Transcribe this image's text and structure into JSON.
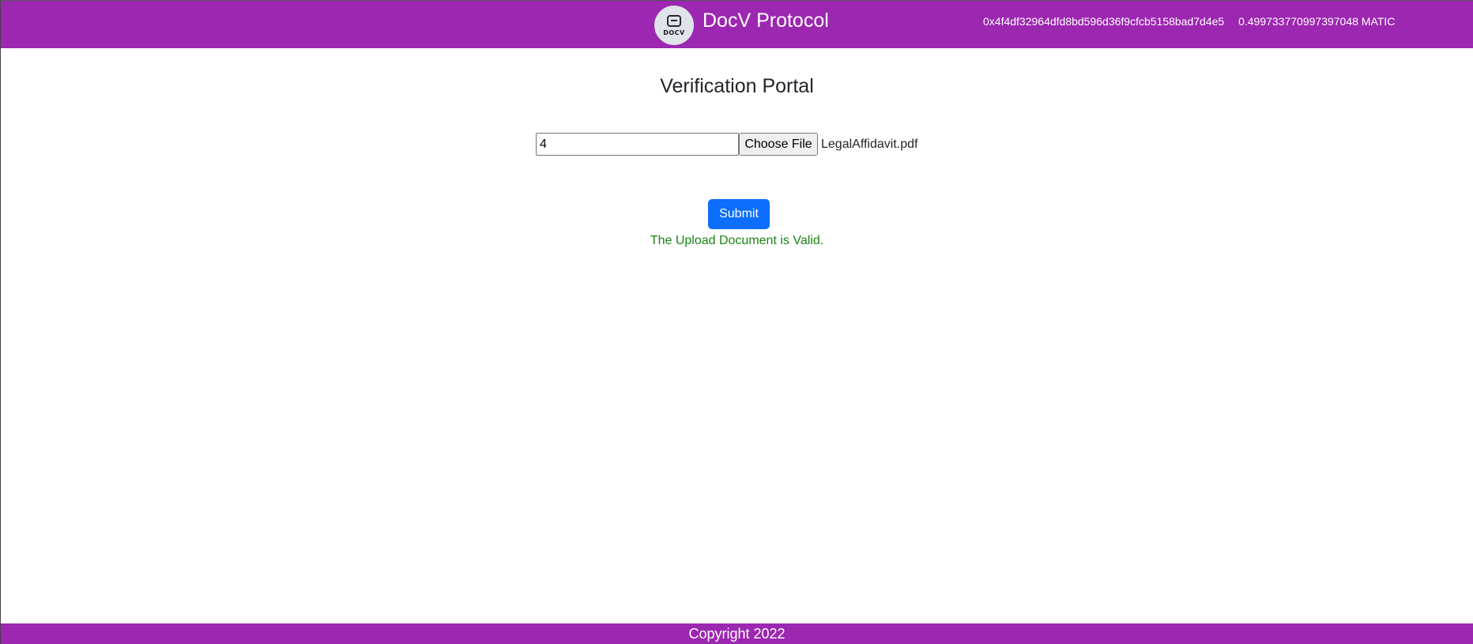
{
  "header": {
    "logo_text": "DOCV",
    "brand_title": "DocV Protocol",
    "wallet_address": "0x4f4df32964dfd8bd596d36f9cfcb5158bad7d4e5",
    "wallet_balance": "0.499733770997397048 MATIC",
    "bar_color": "#9c27b0"
  },
  "main": {
    "title": "Verification Portal",
    "doc_id_value": "4",
    "choose_file_label": "Choose File",
    "selected_file": "LegalAffidavit.pdf",
    "submit_label": "Submit",
    "status_message": "The Upload Document is Valid.",
    "status_color": "#198514",
    "submit_color": "#0d6efd"
  },
  "footer": {
    "copyright": "Copyright 2022"
  },
  "icons": {
    "logo": "docv-logo-icon"
  }
}
